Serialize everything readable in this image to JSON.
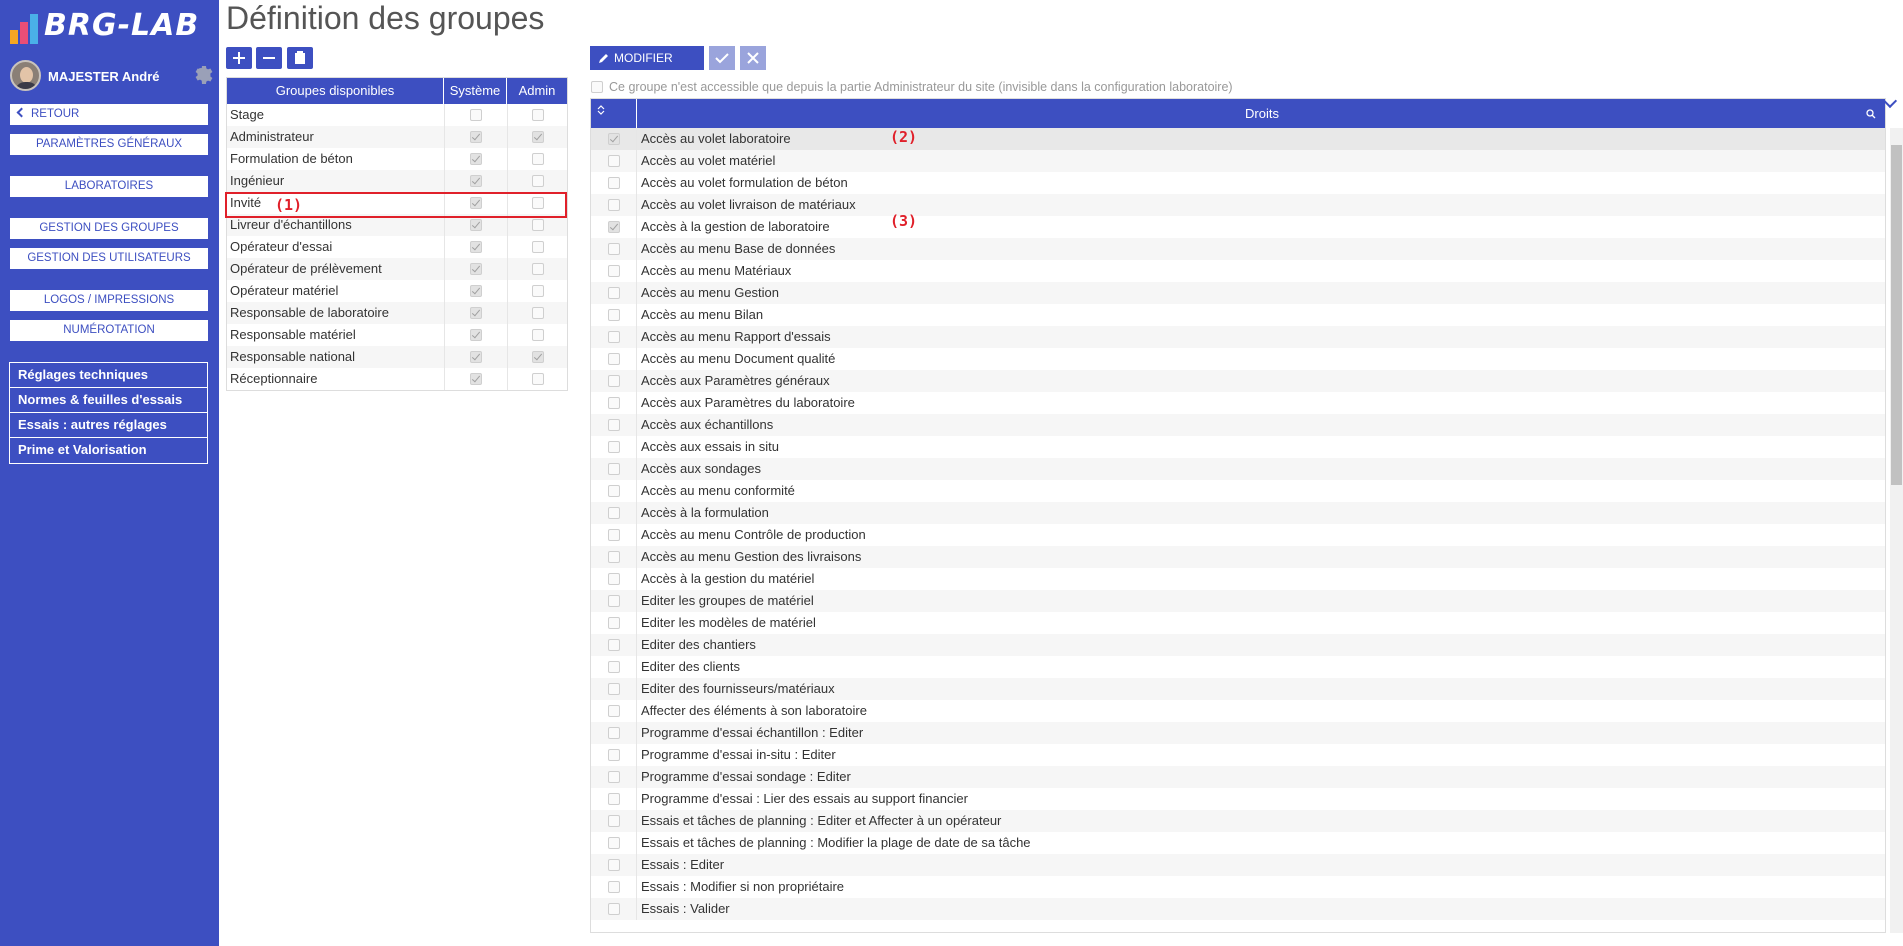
{
  "app": {
    "logo_text": "BRG-LAB",
    "user_name": "MAJESTER André"
  },
  "sidebar": {
    "back": "RETOUR",
    "buttons": [
      "PARAMÈTRES GÉNÉRAUX",
      "LABORATOIRES",
      "GESTION DES GROUPES",
      "GESTION DES UTILISATEURS",
      "LOGOS / IMPRESSIONS",
      "NUMÉROTATION"
    ],
    "group_items": [
      "Réglages techniques",
      "Normes & feuilles d'essais",
      "Essais : autres réglages",
      "Prime et Valorisation"
    ]
  },
  "page": {
    "title": "Définition des groupes"
  },
  "groups_table": {
    "headers": [
      "Groupes disponibles",
      "Système",
      "Admin"
    ],
    "rows": [
      {
        "name": "Stage",
        "systeme": false,
        "admin": false
      },
      {
        "name": "Administrateur",
        "systeme": true,
        "admin": true
      },
      {
        "name": "Formulation de béton",
        "systeme": true,
        "admin": false
      },
      {
        "name": "Ingénieur",
        "systeme": true,
        "admin": false
      },
      {
        "name": "Invité",
        "systeme": true,
        "admin": false
      },
      {
        "name": "Livreur d'échantillons",
        "systeme": true,
        "admin": false
      },
      {
        "name": "Opérateur d'essai",
        "systeme": true,
        "admin": false
      },
      {
        "name": "Opérateur de prélèvement",
        "systeme": true,
        "admin": false
      },
      {
        "name": "Opérateur matériel",
        "systeme": true,
        "admin": false
      },
      {
        "name": "Responsable de laboratoire",
        "systeme": true,
        "admin": false
      },
      {
        "name": "Responsable matériel",
        "systeme": true,
        "admin": false
      },
      {
        "name": "Responsable national",
        "systeme": true,
        "admin": true
      },
      {
        "name": "Réceptionnaire",
        "systeme": true,
        "admin": false
      }
    ],
    "selected_row": "Invité"
  },
  "annotations": {
    "a1": "(1)",
    "a2": "(2)",
    "a3": "(3)"
  },
  "rights": {
    "modify_label": "MODIFIER",
    "access_note": "Ce groupe n'est accessible que depuis la partie Administrateur du site (invisible dans la configuration laboratoire)",
    "header": "Droits",
    "rows": [
      {
        "label": "Accès au volet laboratoire",
        "checked": true
      },
      {
        "label": "Accès au volet matériel",
        "checked": false
      },
      {
        "label": "Accès au volet formulation de béton",
        "checked": false
      },
      {
        "label": "Accès au volet livraison de matériaux",
        "checked": false
      },
      {
        "label": "Accès à la gestion de laboratoire",
        "checked": true
      },
      {
        "label": "Accès au menu Base de données",
        "checked": false
      },
      {
        "label": "Accès au menu Matériaux",
        "checked": false
      },
      {
        "label": "Accès au menu Gestion",
        "checked": false
      },
      {
        "label": "Accès au menu Bilan",
        "checked": false
      },
      {
        "label": "Accès au menu Rapport d'essais",
        "checked": false
      },
      {
        "label": "Accès au menu Document qualité",
        "checked": false
      },
      {
        "label": "Accès aux Paramètres généraux",
        "checked": false
      },
      {
        "label": "Accès aux Paramètres du laboratoire",
        "checked": false
      },
      {
        "label": "Accès aux échantillons",
        "checked": false
      },
      {
        "label": "Accès aux essais in situ",
        "checked": false
      },
      {
        "label": "Accès aux sondages",
        "checked": false
      },
      {
        "label": "Accès au menu conformité",
        "checked": false
      },
      {
        "label": "Accès à la formulation",
        "checked": false
      },
      {
        "label": "Accès au menu Contrôle de production",
        "checked": false
      },
      {
        "label": "Accès au menu Gestion des livraisons",
        "checked": false
      },
      {
        "label": "Accès à la gestion du matériel",
        "checked": false
      },
      {
        "label": "Editer les groupes de matériel",
        "checked": false
      },
      {
        "label": "Editer les modèles de matériel",
        "checked": false
      },
      {
        "label": "Editer des chantiers",
        "checked": false
      },
      {
        "label": "Editer des clients",
        "checked": false
      },
      {
        "label": "Editer des fournisseurs/matériaux",
        "checked": false
      },
      {
        "label": "Affecter des éléments à son laboratoire",
        "checked": false
      },
      {
        "label": "Programme d'essai échantillon : Editer",
        "checked": false
      },
      {
        "label": "Programme d'essai in-situ : Editer",
        "checked": false
      },
      {
        "label": "Programme d'essai sondage : Editer",
        "checked": false
      },
      {
        "label": "Programme d'essai : Lier des essais au support financier",
        "checked": false
      },
      {
        "label": "Essais et tâches de planning : Editer et Affecter à un opérateur",
        "checked": false
      },
      {
        "label": "Essais et tâches de planning : Modifier la plage de date de sa tâche",
        "checked": false
      },
      {
        "label": "Essais : Editer",
        "checked": false
      },
      {
        "label": "Essais : Modifier si non propriétaire",
        "checked": false
      },
      {
        "label": "Essais : Valider",
        "checked": false
      }
    ]
  }
}
